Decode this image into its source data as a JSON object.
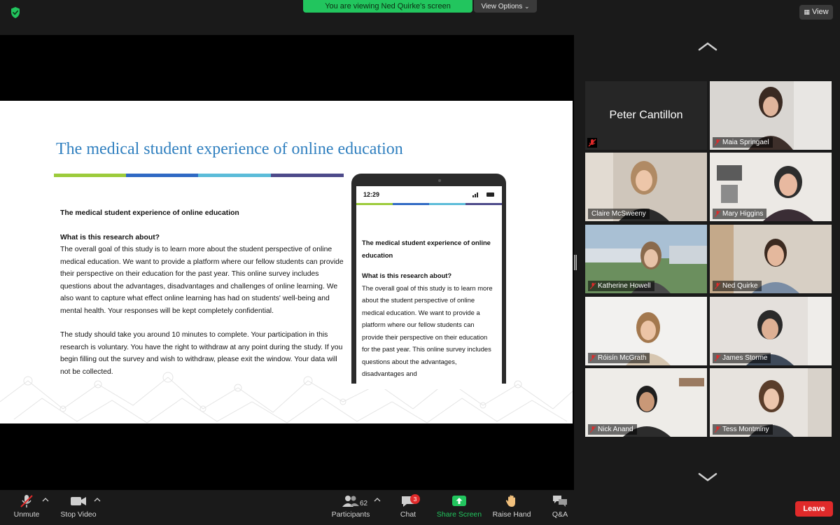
{
  "topbar": {
    "viewing_banner": "You are viewing Ned Quirke's screen",
    "view_options_label": "View Options",
    "view_button_label": "View",
    "shield_icon": "green-shield-icon"
  },
  "slide": {
    "title": "The medical student experience of online education",
    "stripe_colors": [
      "#9ccb3b",
      "#2f69c4",
      "#5bbcd9",
      "#4d4a8a"
    ],
    "body": {
      "heading": "The medical student experience of online education",
      "question": "What is this research about?",
      "paragraph1": "The overall goal of this study is to learn more about the student perspective of online medical education. We want to provide a platform where our fellow students can provide their perspective on their education for the past year. This online survey includes questions about the advantages, disadvantages and challenges of online learning. We also want to capture what effect online learning has had on students' well-being and mental health. Your responses will be kept completely confidential.",
      "paragraph2": "The study should take you around 10 minutes to complete. Your participation in this research is voluntary. You have the right to withdraw at any point during the study. If you begin filling out the survey and wish to withdraw, please exit the window. Your data will not be collected."
    },
    "phone": {
      "time": "12:29",
      "heading": "The medical student experience of online education",
      "question": "What is this research about?",
      "paragraph": "The overall goal of this study is to learn more about the student perspective of online medical education. We want to provide a platform where our fellow students can provide their perspective on their education for the past year. This online survey includes questions about the advantages, disadvantages and"
    }
  },
  "gallery": {
    "participants": [
      {
        "name": "Peter Cantillon",
        "muted": true,
        "video": false
      },
      {
        "name": "Maia Springael",
        "muted": true,
        "video": true
      },
      {
        "name": "Claire McSweeny",
        "muted": false,
        "video": true,
        "speaking": true
      },
      {
        "name": "Mary Higgins",
        "muted": true,
        "video": true
      },
      {
        "name": "Katherine Howell",
        "muted": true,
        "video": true
      },
      {
        "name": "Ned Quirke",
        "muted": true,
        "video": true
      },
      {
        "name": "Róisín McGrath",
        "muted": true,
        "video": true
      },
      {
        "name": "James Storme",
        "muted": true,
        "video": true
      },
      {
        "name": "Nick Anand",
        "muted": true,
        "video": true
      },
      {
        "name": "Tess Montminy",
        "muted": true,
        "video": true
      }
    ]
  },
  "toolbar": {
    "unmute_label": "Unmute",
    "stop_video_label": "Stop Video",
    "participants_label": "Participants",
    "participants_count": "62",
    "chat_label": "Chat",
    "chat_badge": "3",
    "share_screen_label": "Share Screen",
    "raise_hand_label": "Raise Hand",
    "qa_label": "Q&A",
    "leave_label": "Leave"
  },
  "colors": {
    "accent_green": "#22c55e",
    "leave_red": "#e02a2a",
    "active_speaker": "#d9e86a",
    "slide_title": "#2f7fbf"
  }
}
